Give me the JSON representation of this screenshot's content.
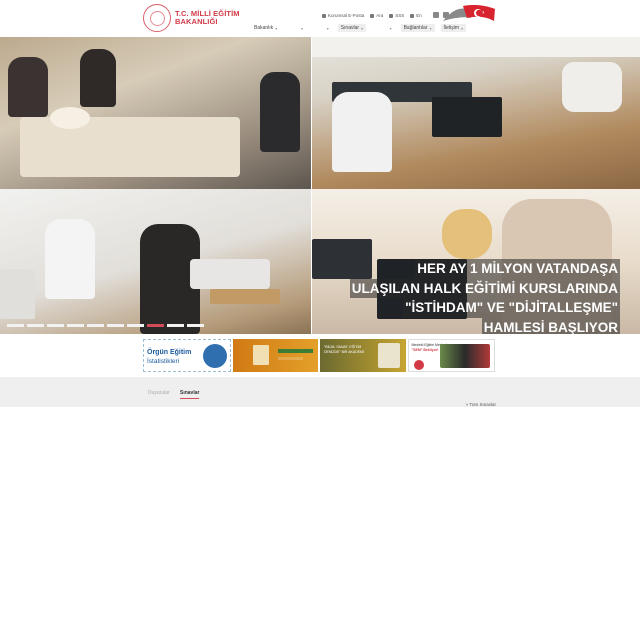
{
  "header": {
    "logo_line1": "T.C. MİLLİ EĞİTİM",
    "logo_line2": "BAKANLIĞI",
    "top_links": [
      "Kurumsal E-Posta",
      "Ara",
      "SSS",
      "En"
    ],
    "nav": [
      "Bakanlık",
      "Sınavlar",
      "Bağlantılar",
      "İletişim"
    ]
  },
  "hero": {
    "headline_lines": [
      "HER AY 1 MİLYON VATANDAŞA",
      "ULAŞILAN HALK EĞİTİMİ KURSLARINDA",
      "\"İSTİHDAM\" VE \"DİJİTALLEŞME\"",
      "HAMLESİ BAŞLIYOR"
    ],
    "slide_count": 10,
    "active_slide": 7
  },
  "banners": {
    "b1_title": "Örgün Eğitim",
    "b1_subtitle": "İstatistikleri",
    "b3_text": "\"BİLİM, SANAT, EĞİTİM DENİZDE\" BİR AKADEMİ",
    "b4_title": "Mesleki Eğitim Merkezi",
    "b4_highlight": "\"SEM\" Bekliyor!"
  },
  "tabs": {
    "items": [
      "Duyurular",
      "Sınavlar"
    ],
    "active": "Sınavlar",
    "all_link": "» Tüm Sınavlar"
  },
  "colors": {
    "brand_red": "#d23a46",
    "accent_pink": "#d24b58"
  }
}
